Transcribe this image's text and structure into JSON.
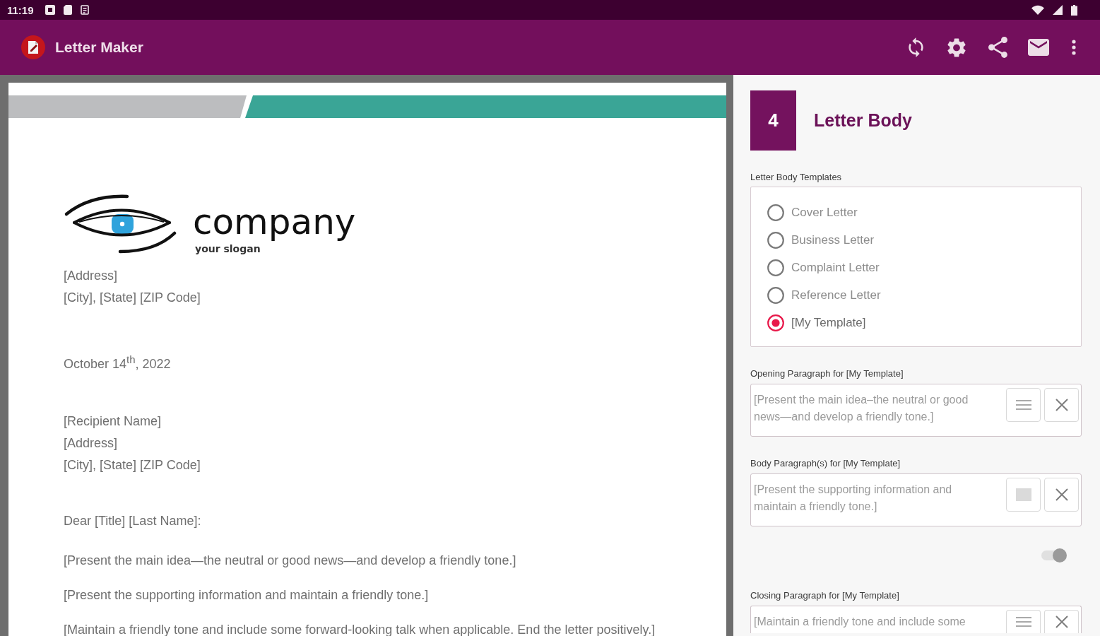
{
  "status_bar": {
    "time": "11:19"
  },
  "app_bar": {
    "title": "Letter Maker",
    "actions": [
      {
        "kind": "refresh"
      },
      {
        "kind": "settings"
      },
      {
        "kind": "share"
      },
      {
        "kind": "mail"
      },
      {
        "kind": "more"
      }
    ]
  },
  "letter": {
    "logo": {
      "name": "company",
      "slogan": "your slogan"
    },
    "sender_lines": [
      "[Address]",
      "[City], [State] [ZIP Code]"
    ],
    "date": "October 14$^{th}$, 2022",
    "recipient_lines": [
      "[Recipient Name]",
      "[Address]",
      "[City], [State] [ZIP Code]"
    ],
    "salutation": "Dear [Title] [Last Name]:",
    "paragraphs": [
      "[Present the main idea—the neutral or good news—and develop a friendly tone.]",
      "[Present the supporting information and maintain a friendly tone.]",
      "[Maintain a friendly tone and include some forward-looking talk when applicable. End the letter positively.]"
    ]
  },
  "editor": {
    "step": "4",
    "title": "Letter Body",
    "templates_label": "Letter Body Templates",
    "templates": [
      {
        "label": "Cover Letter",
        "selected": false
      },
      {
        "label": "Business Letter",
        "selected": false
      },
      {
        "label": "Complaint Letter",
        "selected": false
      },
      {
        "label": "Reference Letter",
        "selected": false
      },
      {
        "label": "[My Template]",
        "selected": true
      }
    ],
    "items": [
      {
        "kind": "field",
        "label": "Opening Paragraph for [My Template]",
        "value": "[Present the main idea–the neutral or good news—and develop a friendly tone.]",
        "buttons": [
          {
            "kind": "lines"
          },
          {
            "kind": "close"
          }
        ]
      },
      {
        "kind": "field",
        "label": "Body Paragraph(s) for [My Template]",
        "value": "[Present the supporting information and maintain a friendly tone.]",
        "buttons": [
          {
            "kind": "square"
          },
          {
            "kind": "close"
          }
        ]
      },
      {
        "kind": "toggle",
        "on": true,
        "disabled": true
      },
      {
        "kind": "field",
        "label": "Closing Paragraph for [My Template]",
        "value": "[Maintain a friendly tone and include some",
        "buttons": [
          {
            "kind": "lines"
          },
          {
            "kind": "close"
          }
        ]
      }
    ]
  }
}
